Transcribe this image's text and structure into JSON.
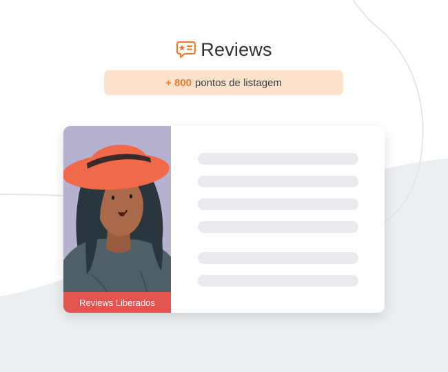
{
  "header": {
    "title": "Reviews",
    "icon": "review-star-icon",
    "accent_color": "#f07a2c"
  },
  "points_banner": {
    "amount": "+ 800",
    "text": "pontos de listagem"
  },
  "card": {
    "image": "woman-with-red-hat-illustration",
    "ribbon_label": "Reviews Liberados",
    "ribbon_color": "#e25550",
    "placeholder_line_count": 6
  }
}
